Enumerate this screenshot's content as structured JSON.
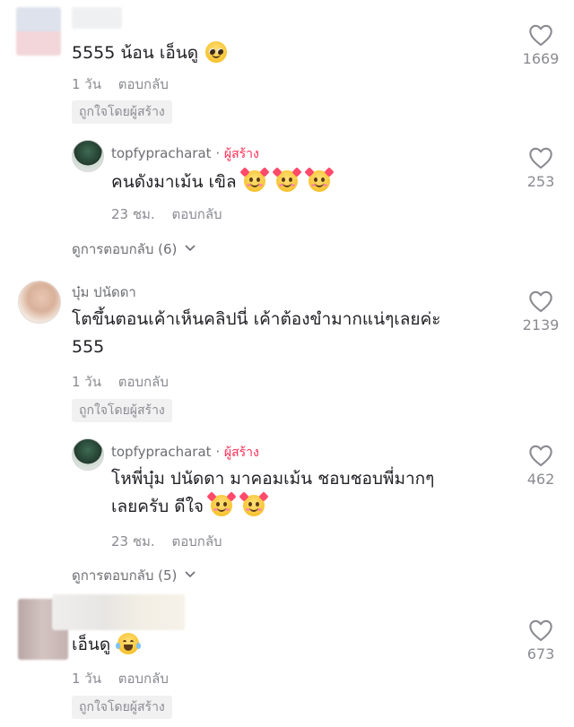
{
  "like_color": "#8a8b91",
  "creator_color": "#fe2c55",
  "comments": [
    {
      "text": "5555 น้อน เอ็นดู",
      "emoji": [
        "pleading-face"
      ],
      "age": "1 วัน",
      "reply_label": "ตอบกลับ",
      "badge": "ถูกใจโดยผู้สร้าง",
      "likes": "1669"
    },
    {
      "username": "topfypracharat",
      "separator": "·",
      "role": "ผู้สร้าง",
      "text": "คนดังมาเม้น เขิล",
      "emoji": [
        "smiling-face-with-hearts",
        "smiling-face-with-hearts",
        "smiling-face-with-hearts"
      ],
      "age": "23 ชม.",
      "reply_label": "ตอบกลับ",
      "likes": "253"
    },
    {
      "more_replies": "ดูการตอบกลับ (6)"
    },
    {
      "username": "บุ๋ม ปนัดดา",
      "text_line1": "โตขึ้นตอนเค้าเห็นคลิปนี่ เค้าต้องขำมากแน่ๆเลยค่ะ",
      "text_line2": "555",
      "age": "1 วัน",
      "reply_label": "ตอบกลับ",
      "badge": "ถูกใจโดยผู้สร้าง",
      "likes": "2139"
    },
    {
      "username": "topfypracharat",
      "separator": "·",
      "role": "ผู้สร้าง",
      "text_line1": "โหพี่บุ๋ม ปนัดดา มาคอมเม้น ชอบชอบพี่มากๆ",
      "text_line2": "เลยครับ ดีใจ",
      "emoji": [
        "smiling-face-with-hearts",
        "smiling-face-with-hearts"
      ],
      "age": "23 ชม.",
      "reply_label": "ตอบกลับ",
      "likes": "462"
    },
    {
      "more_replies": "ดูการตอบกลับ (5)"
    },
    {
      "text": "เอ็นดู",
      "emoji": [
        "face-with-tears-of-joy"
      ],
      "age": "1 วัน",
      "reply_label": "ตอบกลับ",
      "badge": "ถูกใจโดยผู้สร้าง",
      "likes": "673"
    }
  ],
  "icons": {
    "like": "heart-outline-icon",
    "expand": "chevron-down-icon"
  }
}
